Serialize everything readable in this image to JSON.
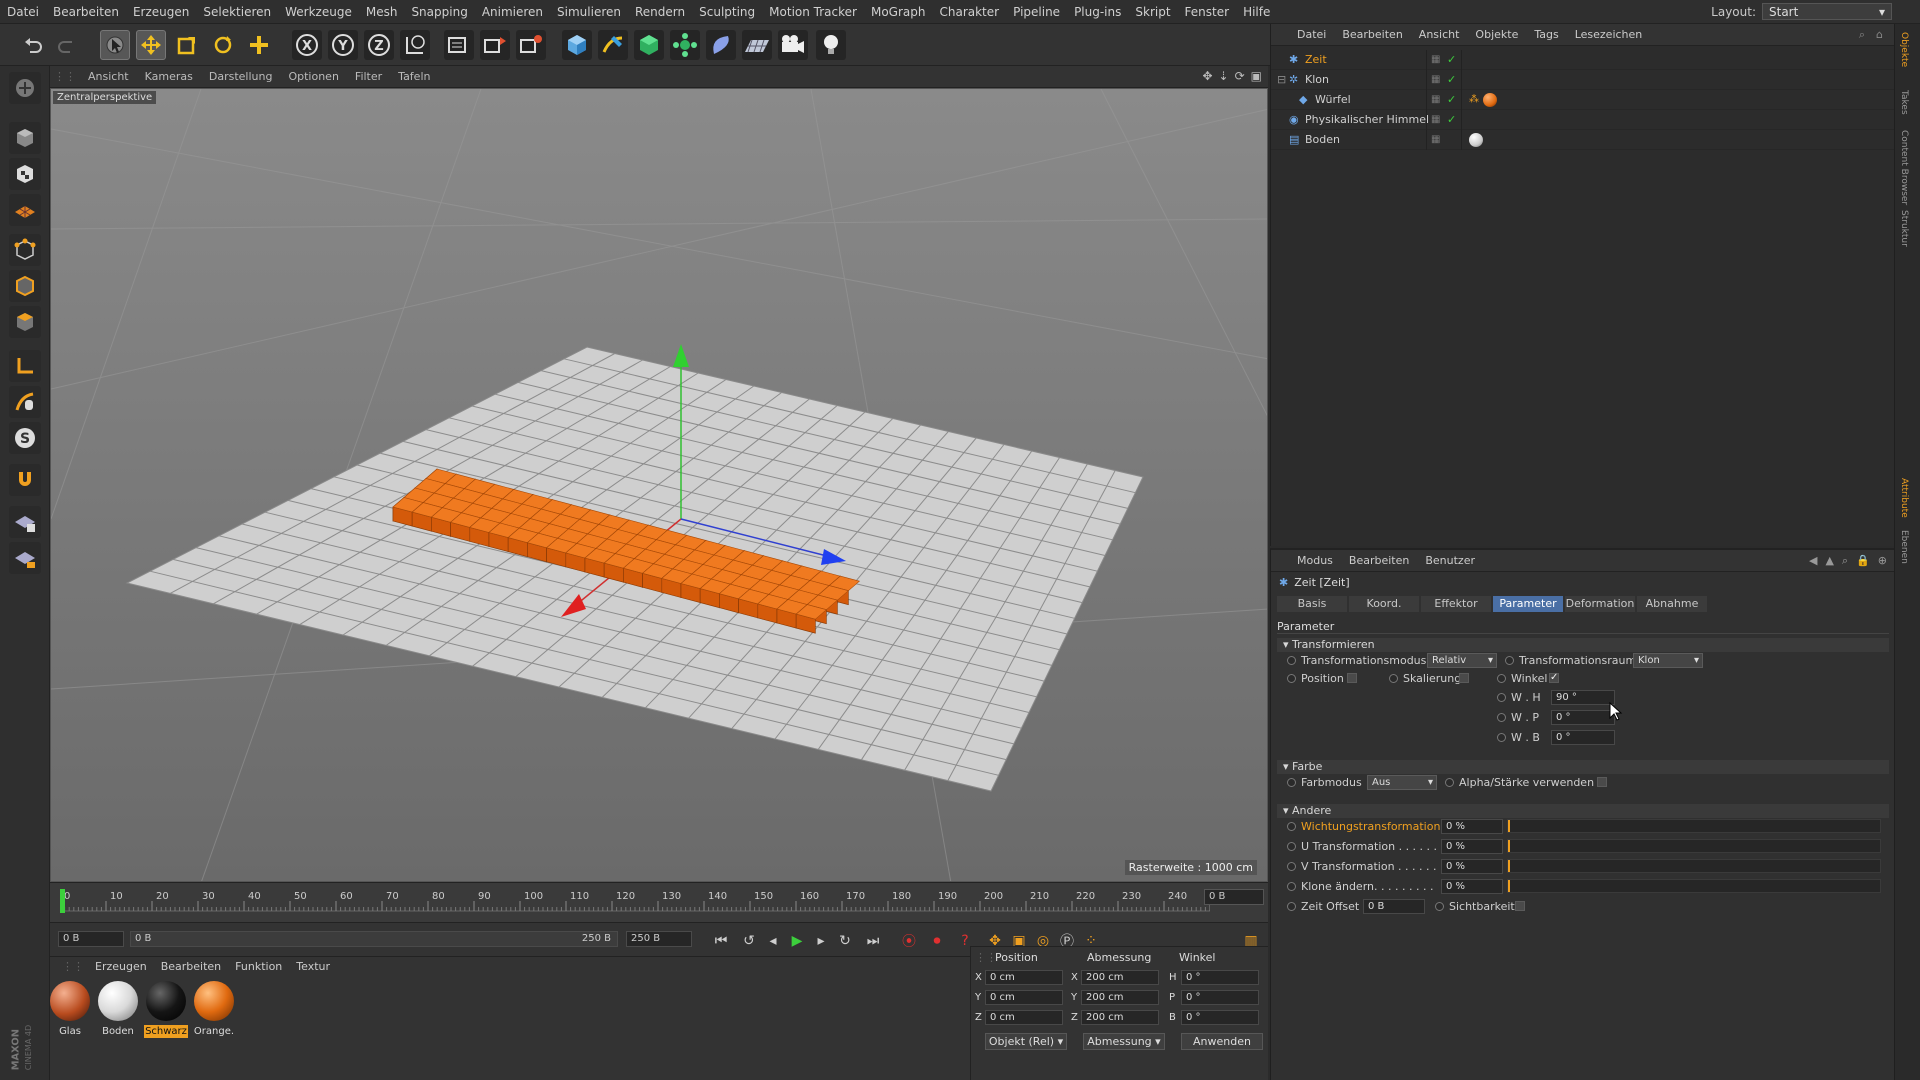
{
  "menubar": {
    "items": [
      "Datei",
      "Bearbeiten",
      "Erzeugen",
      "Selektieren",
      "Werkzeuge",
      "Mesh",
      "Snapping",
      "Animieren",
      "Simulieren",
      "Rendern",
      "Sculpting",
      "Motion Tracker",
      "MoGraph",
      "Charakter",
      "Pipeline",
      "Plug-ins",
      "Skript",
      "Fenster",
      "Hilfe"
    ],
    "layout_label": "Layout:",
    "layout_value": "Start"
  },
  "toolbar": {
    "tools": [
      "undo-icon",
      "redo-icon",
      "select-icon",
      "move-icon",
      "scale-icon",
      "rotate-icon",
      "add-icon",
      "x-axis-icon",
      "y-axis-icon",
      "z-axis-icon",
      "coordinate-system-icon",
      "render-view-icon",
      "render-picture-icon",
      "render-settings-icon",
      "cube-icon",
      "spline-pen-icon",
      "nurbs-icon",
      "array-icon",
      "deformer-icon",
      "floor-icon",
      "camera-icon",
      "light-icon"
    ],
    "axis_labels": [
      "X",
      "Y",
      "Z"
    ]
  },
  "viewport": {
    "menu": [
      "Ansicht",
      "Kameras",
      "Darstellung",
      "Optionen",
      "Filter",
      "Tafeln"
    ],
    "label": "Zentralperspektive",
    "raster": "Rasterweite : 1000 cm"
  },
  "timeline": {
    "ticks": [
      "0",
      "10",
      "20",
      "30",
      "40",
      "50",
      "60",
      "70",
      "80",
      "90",
      "100",
      "110",
      "120",
      "130",
      "140",
      "150",
      "160",
      "170",
      "180",
      "190",
      "200",
      "210",
      "220",
      "230",
      "240",
      "250"
    ],
    "frame_right": "0 B"
  },
  "transport": {
    "current": "0 B",
    "range_start": "0 B",
    "range_end": "250 B",
    "end_field": "250 B"
  },
  "materials": {
    "menu": [
      "Erzeugen",
      "Bearbeiten",
      "Funktion",
      "Textur"
    ],
    "items": [
      {
        "label": "Glas",
        "color": "#b84b1e"
      },
      {
        "label": "Boden",
        "color": "#d9d9d9"
      },
      {
        "label": "Schwarz",
        "color": "#151515"
      },
      {
        "label": "Orange.",
        "color": "#e06a10"
      }
    ]
  },
  "coords": {
    "headers": [
      "Position",
      "Abmessung",
      "Winkel"
    ],
    "rows": [
      {
        "axis": "X",
        "pos": "0 cm",
        "size_axis": "X",
        "size": "200 cm",
        "rot_axis": "H",
        "rot": "0 °"
      },
      {
        "axis": "Y",
        "pos": "0 cm",
        "size_axis": "Y",
        "size": "200 cm",
        "rot_axis": "P",
        "rot": "0 °"
      },
      {
        "axis": "Z",
        "pos": "0 cm",
        "size_axis": "Z",
        "size": "200 cm",
        "rot_axis": "B",
        "rot": "0 °"
      }
    ],
    "mode_dropdown": "Objekt (Rel)",
    "size_dropdown": "Abmessung",
    "apply_label": "Anwenden"
  },
  "object_manager": {
    "menu": [
      "Datei",
      "Bearbeiten",
      "Ansicht",
      "Objekte",
      "Tags",
      "Lesezeichen"
    ],
    "objects": [
      {
        "name": "Zeit"
      },
      {
        "name": "Klon"
      },
      {
        "name": "Würfel"
      },
      {
        "name": "Physikalischer Himmel"
      },
      {
        "name": "Boden"
      }
    ]
  },
  "attributes": {
    "menu": [
      "Modus",
      "Bearbeiten",
      "Benutzer"
    ],
    "title": "Zeit [Zeit]",
    "tabs": [
      "Basis",
      "Koord.",
      "Effektor",
      "Parameter",
      "Deformation",
      "Abnahme"
    ],
    "active_tab": "Parameter",
    "section_header": "Parameter",
    "transform": {
      "header": "Transformieren",
      "mode_label": "Transformationsmodus",
      "mode_value": "Relativ",
      "space_label": "Transformationsraum",
      "space_value": "Klon",
      "position_label": "Position",
      "scale_label": "Skalierung",
      "angle_label": "Winkel",
      "wh_label": "W . H",
      "wh_value": "90 °",
      "wp_label": "W . P",
      "wp_value": "0 °",
      "wb_label": "W . B",
      "wb_value": "0 °"
    },
    "color": {
      "header": "Farbe",
      "mode_label": "Farbmodus",
      "mode_value": "Aus",
      "alpha_label": "Alpha/Stärke verwenden"
    },
    "other": {
      "header": "Andere",
      "weight_label": "Wichtungstransformation",
      "weight_value": "0 %",
      "u_label": "U Transformation . . . . . .",
      "u_value": "0 %",
      "v_label": "V Transformation . . . . . .",
      "v_value": "0 %",
      "clone_label": "Klone ändern. . . . . . . . .",
      "clone_value": "0 %",
      "offset_label": "Zeit Offset",
      "offset_value": "0 B",
      "visibility_label": "Sichtbarkeit"
    }
  },
  "colors": {
    "accent": "#4a6fa5",
    "highlight_orange": "#f0a020",
    "clone_orange": "#e0600f"
  }
}
